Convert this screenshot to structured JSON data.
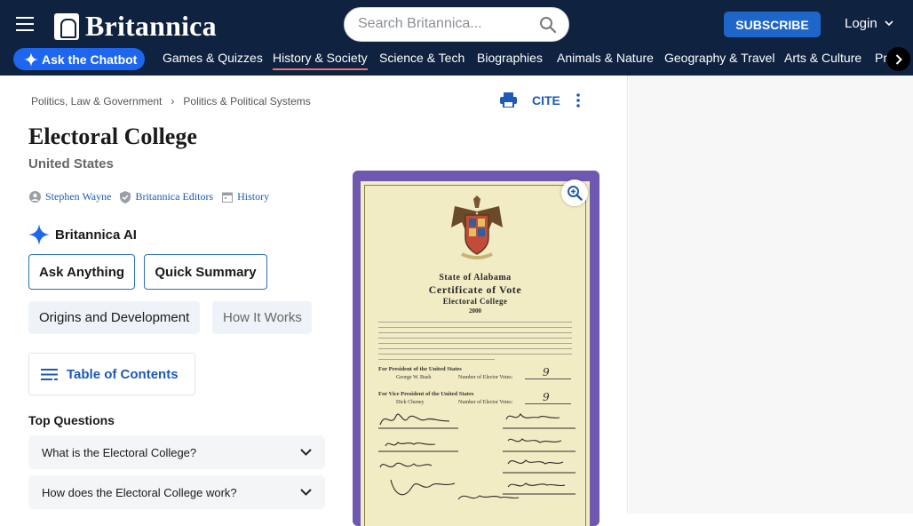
{
  "header": {
    "logo_text": "Britannica",
    "search_placeholder": "Search Britannica...",
    "subscribe_label": "SUBSCRIBE",
    "login_label": "Login"
  },
  "nav": {
    "chatbot_label": "Ask the Chatbot",
    "items": [
      "Games & Quizzes",
      "History & Society",
      "Science & Tech",
      "Biographies",
      "Animals & Nature",
      "Geography & Travel",
      "Arts & Culture",
      "Pr"
    ],
    "active_index": 1
  },
  "breadcrumb": {
    "items": [
      "Politics, Law & Government",
      "Politics & Political Systems"
    ],
    "separator": "›"
  },
  "tools": {
    "cite_label": "CITE"
  },
  "article": {
    "title": "Electoral College",
    "subtitle": "United States",
    "meta": {
      "author": "Stephen Wayne",
      "editors": "Britannica Editors",
      "history": "History"
    }
  },
  "ai": {
    "heading": "Britannica AI",
    "buttons": [
      "Ask Anything",
      "Quick Summary"
    ],
    "chips": [
      "Origins and Development",
      "How It Works"
    ]
  },
  "toc_label": "Table of Contents",
  "top_questions": {
    "heading": "Top Questions",
    "items": [
      "What is the Electoral College?",
      "How does the Electoral College work?"
    ]
  },
  "certificate": {
    "line1": "State of Alabama",
    "line2": "Certificate of Vote",
    "line3": "Electoral College",
    "year": "2000",
    "president_label": "For President of the United States",
    "president_name": "George W. Bush",
    "president_votes_label": "Number of Elector Votes:",
    "president_votes": "9",
    "vp_label": "For Vice President of the United States",
    "vp_name": "Dick Cheney",
    "vp_votes_label": "Number of Elector Votes:",
    "vp_votes": "9"
  },
  "colors": {
    "header_bg": "#0f2240",
    "accent": "#1e66c9",
    "link": "#1d5ab5",
    "figure_frame": "#6e58b0"
  }
}
